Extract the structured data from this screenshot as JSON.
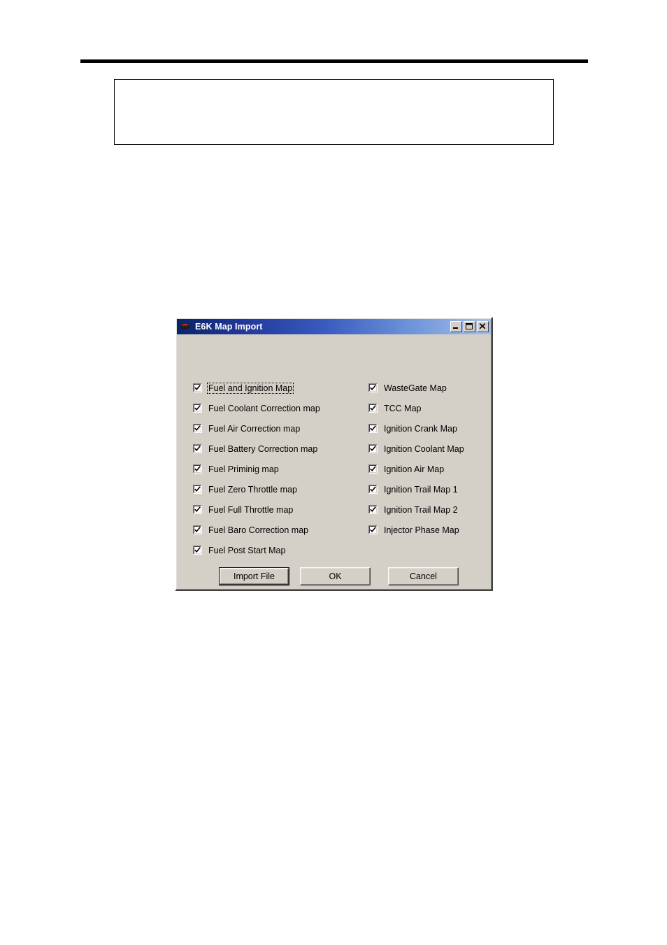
{
  "page": {
    "rule": "horizontal-rule",
    "empty_box": ""
  },
  "dialog": {
    "title": "E6K Map Import",
    "icon": "ecu-module-icon",
    "window_controls": [
      {
        "name": "minimize",
        "glyph": "_"
      },
      {
        "name": "maximize",
        "glyph": "□"
      },
      {
        "name": "close",
        "glyph": "✕"
      }
    ],
    "left_column": [
      {
        "label": "Fuel and Ignition Map",
        "checked": true,
        "focused": true
      },
      {
        "label": "Fuel Coolant Correction map",
        "checked": true,
        "focused": false
      },
      {
        "label": "Fuel Air Correction map",
        "checked": true,
        "focused": false
      },
      {
        "label": "Fuel Battery Correction map",
        "checked": true,
        "focused": false
      },
      {
        "label": "Fuel Priminig map",
        "checked": true,
        "focused": false
      },
      {
        "label": "Fuel Zero Throttle map",
        "checked": true,
        "focused": false
      },
      {
        "label": "Fuel Full Throttle map",
        "checked": true,
        "focused": false
      },
      {
        "label": "Fuel Baro Correction map",
        "checked": true,
        "focused": false
      },
      {
        "label": "Fuel Post Start Map",
        "checked": true,
        "focused": false
      }
    ],
    "right_column": [
      {
        "label": "WasteGate Map",
        "checked": true,
        "focused": false
      },
      {
        "label": "TCC Map",
        "checked": true,
        "focused": false
      },
      {
        "label": "Ignition Crank Map",
        "checked": true,
        "focused": false
      },
      {
        "label": "Ignition Coolant Map",
        "checked": true,
        "focused": false
      },
      {
        "label": "Ignition Air Map",
        "checked": true,
        "focused": false
      },
      {
        "label": "Ignition Trail Map 1",
        "checked": true,
        "focused": false
      },
      {
        "label": "Ignition Trail Map 2",
        "checked": true,
        "focused": false
      },
      {
        "label": "Injector Phase Map",
        "checked": true,
        "focused": false
      }
    ],
    "buttons": {
      "import": "Import File",
      "ok": "OK",
      "cancel": "Cancel"
    }
  },
  "colors": {
    "dialog_face": "#d4d0c8",
    "titlebar_start": "#0a246a",
    "titlebar_end": "#a6c0ea",
    "title_text": "#ffffff",
    "text": "#000000",
    "checkbox_field": "#ffffff"
  }
}
